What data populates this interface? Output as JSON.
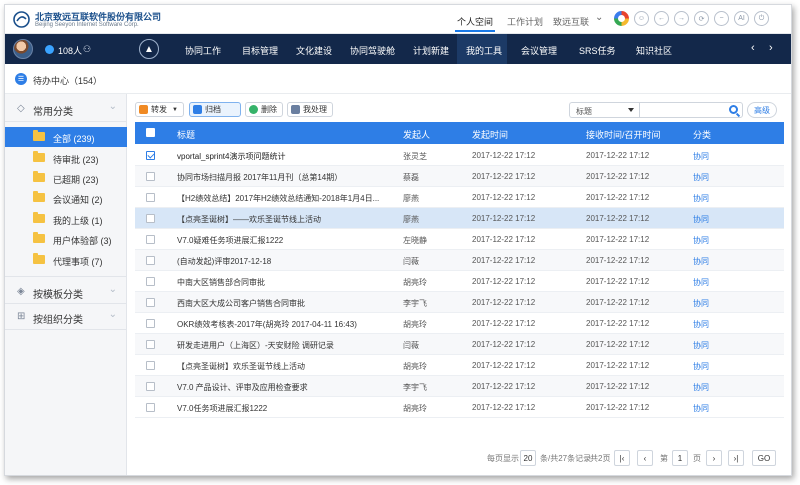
{
  "header": {
    "company_cn": "北京致远互联软件股份有限公司",
    "company_en": "Beijing Seeyon Internet Software Corp.",
    "nav": [
      {
        "label": "个人空间",
        "active": true
      },
      {
        "label": "工作计划",
        "active": false
      },
      {
        "label": "致远互联",
        "active": false
      }
    ],
    "dropdown_caret": "⌄",
    "icons": [
      "app-center-icon",
      "message-icon",
      "back-icon",
      "forward-icon",
      "refresh-icon",
      "minus-icon",
      "ai-icon",
      "power-icon"
    ],
    "icon_glyphs": [
      "",
      "☺",
      "←",
      "→",
      "⟳",
      "−",
      "AI",
      "⏻"
    ]
  },
  "navbar": {
    "user_count": "108人",
    "user_glyph": "⚇",
    "home_glyph": "▲",
    "items": [
      "协同工作",
      "目标管理",
      "文化建设",
      "协同驾驶舱",
      "计划新建",
      "我的工具",
      "会议管理",
      "SRS任务",
      "知识社区"
    ],
    "arrow_left": "‹",
    "arrow_right": "›"
  },
  "subhead": {
    "title": "待办中心（154）"
  },
  "sidebar": {
    "common_title": "常用分类",
    "items": [
      {
        "label": "全部 (239)",
        "active": true
      },
      {
        "label": "待审批 (23)",
        "active": false
      },
      {
        "label": "已超期 (23)",
        "active": false
      },
      {
        "label": "会议通知 (2)",
        "active": false
      },
      {
        "label": "我的上级 (1)",
        "active": false
      },
      {
        "label": "用户体验部 (3)",
        "active": false
      },
      {
        "label": "代理事项 (7)",
        "active": false
      }
    ],
    "template_title": "按模板分类",
    "org_title": "按组织分类",
    "chevron": "⌄"
  },
  "toolbar": {
    "forward": "转发",
    "archive": "归档",
    "delete": "删除",
    "handled": "我处理",
    "search_field": "标题",
    "search_value": "",
    "advanced": "高级"
  },
  "table": {
    "headers": {
      "title": "标题",
      "sender": "发起人",
      "start_time": "发起时间",
      "receive_time": "接收时间/召开时间",
      "category": "分类"
    },
    "rows": [
      {
        "title": "vportal_sprint4演示项问题统计",
        "sender": "张灵芝",
        "start": "2017-12-22 17:12",
        "receive": "2017-12-22 17:12",
        "category": "协同",
        "checked": true,
        "bold": true
      },
      {
        "title": "协同市场扫描月报 2017年11月刊（总第14期）",
        "sender": "蔡磊",
        "start": "2017-12-22 17:12",
        "receive": "2017-12-22 17:12",
        "category": "协同",
        "checked": false,
        "bold": false
      },
      {
        "title": "【H2绩效总结】2017年H2绩效总结通知-2018年1月4日...",
        "sender": "廖燕",
        "start": "2017-12-22 17:12",
        "receive": "2017-12-22 17:12",
        "category": "协同",
        "checked": false,
        "bold": false
      },
      {
        "title": "【点亮圣诞树】——欢乐圣诞节线上活动",
        "sender": "廖燕",
        "start": "2017-12-22 17:12",
        "receive": "2017-12-22 17:12",
        "category": "协同",
        "checked": false,
        "bold": false
      },
      {
        "title": "V7.0疑难任务项进展汇报1222",
        "sender": "左晓静",
        "start": "2017-12-22 17:12",
        "receive": "2017-12-22 17:12",
        "category": "协同",
        "checked": false,
        "bold": false
      },
      {
        "title": "(自动发起)评审2017-12-18",
        "sender": "闫薇",
        "start": "2017-12-22 17:12",
        "receive": "2017-12-22 17:12",
        "category": "协同",
        "checked": false,
        "bold": false
      },
      {
        "title": "中南大区销售部合同审批",
        "sender": "胡亮玲",
        "start": "2017-12-22 17:12",
        "receive": "2017-12-22 17:12",
        "category": "协同",
        "checked": false,
        "bold": false
      },
      {
        "title": "西南大区大成公司客户销售合同审批",
        "sender": "李宇飞",
        "start": "2017-12-22 17:12",
        "receive": "2017-12-22 17:12",
        "category": "协同",
        "checked": false,
        "bold": false
      },
      {
        "title": "OKR绩效考核表-2017年(胡亮玲 2017-04-11 16:43)",
        "sender": "胡亮玲",
        "start": "2017-12-22 17:12",
        "receive": "2017-12-22 17:12",
        "category": "协同",
        "checked": false,
        "bold": false
      },
      {
        "title": "研发走进用户（上海区）-天安财险 调研记录",
        "sender": "闫薇",
        "start": "2017-12-22 17:12",
        "receive": "2017-12-22 17:12",
        "category": "协同",
        "checked": false,
        "bold": false
      },
      {
        "title": "【点亮圣诞树】欢乐圣诞节线上活动",
        "sender": "胡亮玲",
        "start": "2017-12-22 17:12",
        "receive": "2017-12-22 17:12",
        "category": "协同",
        "checked": false,
        "bold": false
      },
      {
        "title": "V7.0 产品设计、评审及应用检查要求",
        "sender": "李宇飞",
        "start": "2017-12-22 17:12",
        "receive": "2017-12-22 17:12",
        "category": "协同",
        "checked": false,
        "bold": false
      },
      {
        "title": "V7.0任务项进展汇报1222",
        "sender": "胡亮玲",
        "start": "2017-12-22 17:12",
        "receive": "2017-12-22 17:12",
        "category": "协同",
        "checked": false,
        "bold": false
      }
    ]
  },
  "pagination": {
    "per_page_label": "每页显示",
    "per_page": "20",
    "summary": "条/共27条记录",
    "pages": "共2页",
    "first": "|‹",
    "prev": "‹",
    "page_label": "第",
    "page": "1",
    "page_unit": "页",
    "next": "›",
    "last": "›|",
    "go": "GO"
  }
}
